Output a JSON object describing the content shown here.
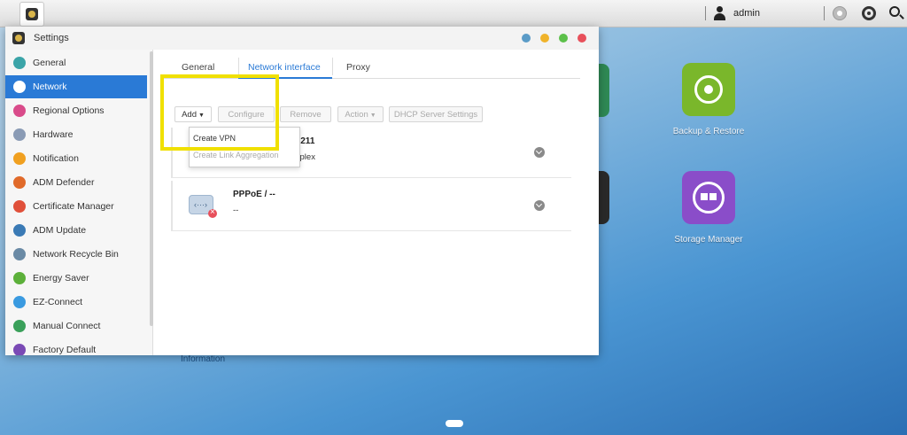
{
  "taskbar": {
    "user_name": "admin",
    "icons": [
      "app-launcher-icon",
      "user-icon",
      "notification-icon",
      "sync-icon",
      "search-icon"
    ]
  },
  "desktop": {
    "apps": [
      {
        "label": "Backup & Restore",
        "color": "#7ab72b"
      },
      {
        "label": "Storage Manager",
        "color": "#8a4dc9"
      }
    ],
    "behind_text": "Information"
  },
  "window": {
    "title": "Settings",
    "controls": [
      "help",
      "minimize",
      "maximize",
      "close"
    ]
  },
  "sidebar": {
    "items": [
      {
        "label": "General",
        "icon": "general-icon",
        "color": "#3ba4a8"
      },
      {
        "label": "Network",
        "icon": "network-icon",
        "color": "#2a7ad6",
        "active": true
      },
      {
        "label": "Regional Options",
        "icon": "globe-icon",
        "color": "#d94b8a"
      },
      {
        "label": "Hardware",
        "icon": "hardware-icon",
        "color": "#8a9bb5"
      },
      {
        "label": "Notification",
        "icon": "notification-icon",
        "color": "#f0a020"
      },
      {
        "label": "ADM Defender",
        "icon": "defender-icon",
        "color": "#e06a2a"
      },
      {
        "label": "Certificate Manager",
        "icon": "certificate-icon",
        "color": "#e0503a"
      },
      {
        "label": "ADM Update",
        "icon": "update-icon",
        "color": "#3a7ab5"
      },
      {
        "label": "Network Recycle Bin",
        "icon": "recycle-bin-icon",
        "color": "#6a8aa5"
      },
      {
        "label": "Energy Saver",
        "icon": "energy-icon",
        "color": "#5cb03a"
      },
      {
        "label": "EZ-Connect",
        "icon": "cloud-icon",
        "color": "#3a9ae0"
      },
      {
        "label": "Manual Connect",
        "icon": "manual-connect-icon",
        "color": "#3aa05a"
      },
      {
        "label": "Factory Default",
        "icon": "factory-default-icon",
        "color": "#7a4ab5"
      }
    ]
  },
  "tabs": [
    {
      "label": "General"
    },
    {
      "label": "Network interface",
      "active": true
    },
    {
      "label": "Proxy"
    }
  ],
  "toolbar": {
    "add": "Add",
    "configure": "Configure",
    "remove": "Remove",
    "action": "Action",
    "dhcp": "DHCP Server Settings"
  },
  "dropdown": {
    "items": [
      {
        "label": "Create VPN",
        "enabled": true
      },
      {
        "label": "Create Link Aggregation",
        "enabled": false
      }
    ]
  },
  "interfaces": [
    {
      "title": "8.42.211",
      "subtitle": "1000Mb/s, Full duplex",
      "status": "connected"
    },
    {
      "title": "PPPoE / --",
      "subtitle": "--",
      "status": "disconnected"
    }
  ]
}
